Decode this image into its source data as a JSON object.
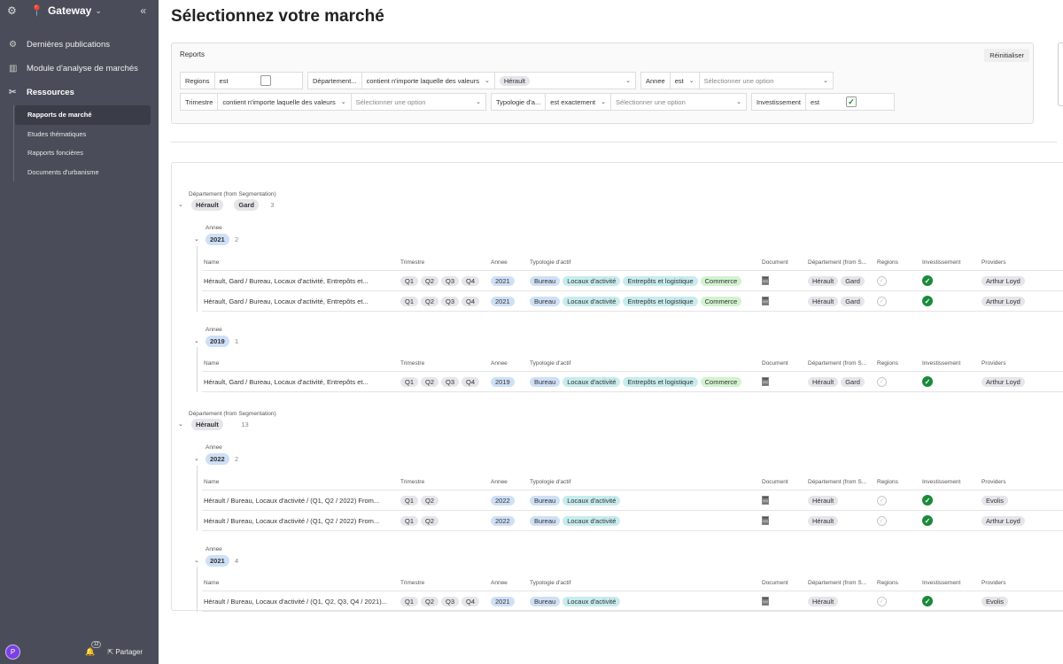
{
  "sidebar": {
    "brand": "Gateway",
    "nav": [
      {
        "label": "Dernières publications"
      },
      {
        "label": "Module d'analyse de marchés"
      },
      {
        "label": "Ressources"
      }
    ],
    "sub": [
      {
        "label": "Rapports de marché"
      },
      {
        "label": "Etudes thématiques"
      },
      {
        "label": "Rapports foncières"
      },
      {
        "label": "Documents d'urbanisme"
      }
    ],
    "avatar": "P",
    "bell_count": "12",
    "share": "Partager"
  },
  "page": {
    "title": "Sélectionnez votre marché"
  },
  "reports": {
    "title": "Reports",
    "reset": "Réinitialiser",
    "f1": {
      "field": "Regions",
      "op": "est"
    },
    "f2": {
      "field": "Département...",
      "op": "contient n'importe laquelle des valeurs",
      "value": "Hérault"
    },
    "f3": {
      "field": "Annee",
      "op": "est",
      "placeholder": "Sélectionner une option"
    },
    "f4": {
      "field": "Trimestre",
      "op": "contient n'importe laquelle des valeurs",
      "placeholder": "Sélectionner une option"
    },
    "f5": {
      "field": "Typologie d'a...",
      "op": "est exactement",
      "placeholder": "Sélectionner une option"
    },
    "f6": {
      "field": "Investissement",
      "op": "est"
    }
  },
  "grid": {
    "group_label": "Département (from Segmentation)",
    "year_label": "Annee",
    "columns": {
      "name": "Name",
      "trimestre": "Trimestre",
      "annee": "Annee",
      "typo": "Typologie d'actif",
      "document": "Document",
      "dept": "Département (from S...",
      "regions": "Regions",
      "invest": "Investissement",
      "providers": "Providers"
    },
    "g1": {
      "tags": [
        "Hérault",
        "Gard"
      ],
      "count": "3",
      "y1": {
        "year": "2021",
        "count": "2",
        "rows": [
          {
            "name": "Hérault, Gard / Bureau, Locaux d'activité, Entrepôts et...",
            "q": [
              "Q1",
              "Q2",
              "Q3",
              "Q4"
            ],
            "annee": "2021",
            "typo": [
              "Bureau",
              "Locaux d'activité",
              "Entrepôts et logistique",
              "Commerce"
            ],
            "dept": [
              "Hérault",
              "Gard"
            ],
            "provider": "Arthur Loyd"
          },
          {
            "name": "Hérault, Gard / Bureau, Locaux d'activité, Entrepôts et...",
            "q": [
              "Q1",
              "Q2",
              "Q3",
              "Q4"
            ],
            "annee": "2021",
            "typo": [
              "Bureau",
              "Locaux d'activité",
              "Entrepôts et logistique",
              "Commerce"
            ],
            "dept": [
              "Hérault",
              "Gard"
            ],
            "provider": "Arthur Loyd"
          }
        ]
      },
      "y2": {
        "year": "2019",
        "count": "1",
        "rows": [
          {
            "name": "Hérault, Gard / Bureau, Locaux d'activité, Entrepôts et...",
            "q": [
              "Q1",
              "Q2",
              "Q3",
              "Q4"
            ],
            "annee": "2019",
            "typo": [
              "Bureau",
              "Locaux d'activité",
              "Entrepôts et logistique",
              "Commerce"
            ],
            "dept": [
              "Hérault",
              "Gard"
            ],
            "provider": "Arthur Loyd"
          }
        ]
      }
    },
    "g2": {
      "tags": [
        "Hérault"
      ],
      "count": "13",
      "y1": {
        "year": "2022",
        "count": "2",
        "rows": [
          {
            "name": "Hérault / Bureau, Locaux d'activité / (Q1, Q2 / 2022) From...",
            "q": [
              "Q1",
              "Q2"
            ],
            "annee": "2022",
            "typo": [
              "Bureau",
              "Locaux d'activité"
            ],
            "dept": [
              "Hérault"
            ],
            "provider": "Evolis"
          },
          {
            "name": "Hérault / Bureau, Locaux d'activité / (Q1, Q2 / 2022) From...",
            "q": [
              "Q1",
              "Q2"
            ],
            "annee": "2022",
            "typo": [
              "Bureau",
              "Locaux d'activité"
            ],
            "dept": [
              "Hérault"
            ],
            "provider": "Arthur Loyd"
          }
        ]
      },
      "y2": {
        "year": "2021",
        "count": "4",
        "rows": [
          {
            "name": "Hérault / Bureau, Locaux d'activité / (Q1, Q2, Q3, Q4 / 2021)...",
            "q": [
              "Q1",
              "Q2",
              "Q3",
              "Q4"
            ],
            "annee": "2021",
            "typo": [
              "Bureau",
              "Locaux d'activité"
            ],
            "dept": [
              "Hérault"
            ],
            "provider": "Evolis"
          }
        ]
      }
    }
  }
}
